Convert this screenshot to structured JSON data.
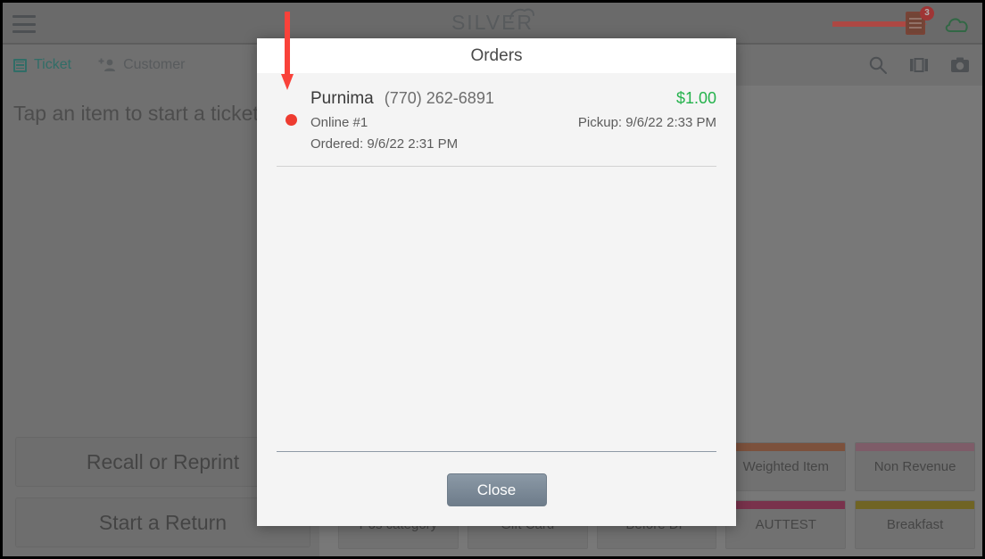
{
  "topbar": {
    "menu_icon": "hamburger-menu-icon",
    "logo_text": "SILVER",
    "orders_icon": "orders-receipt-icon",
    "orders_badge": "3",
    "cloud_icon": "cloud-icon",
    "annotation_arrow": "red-arrow-pointing-right"
  },
  "subbar": {
    "tabs": [
      {
        "label": "Ticket",
        "icon": "ticket-icon",
        "active": true
      },
      {
        "label": "Customer",
        "icon": "add-person-icon",
        "active": false
      }
    ],
    "icons": [
      {
        "name": "search-icon"
      },
      {
        "name": "columns-layout-icon"
      },
      {
        "name": "camera-icon"
      }
    ]
  },
  "ticket_pane": {
    "hint": "Tap an item to start a ticket",
    "actions": [
      {
        "label": "Recall or Reprint"
      },
      {
        "label": "Start a Return"
      }
    ]
  },
  "grid_pane": {
    "rows": [
      [
        {
          "label": "",
          "color": "#8d8d8d",
          "blank": true
        },
        {
          "label": "",
          "color": "#8d8d8d",
          "blank": true
        },
        {
          "label": "",
          "color": "#8d8d8d",
          "blank": true
        },
        {
          "label": "Weighted Item",
          "color": "#a0522d"
        },
        {
          "label": "Non Revenue",
          "color": "#a5677c"
        }
      ],
      [
        {
          "label": "Pos category",
          "color": "#8d8d8d",
          "blank": true
        },
        {
          "label": "Gift Card",
          "color": "#8d8d8d",
          "blank": true
        },
        {
          "label": "Before DP",
          "color": "#8d8d8d",
          "blank": true
        },
        {
          "label": "AUTTEST",
          "color": "#9b1b4a"
        },
        {
          "label": "Breakfast",
          "color": "#8b7500"
        }
      ]
    ]
  },
  "dialog": {
    "title": "Orders",
    "annotation_arrow": "red-arrow-pointing-down",
    "orders": [
      {
        "status_color": "#ee3b30",
        "customer_name": "Purnima",
        "customer_phone": "(770) 262-6891",
        "total": "$1.00",
        "channel": "Online #1",
        "pickup": "Pickup: 9/6/22 2:33 PM",
        "ordered": "Ordered: 9/6/22 2:31 PM"
      }
    ],
    "close_label": "Close"
  },
  "colors": {
    "accent_teal": "#18857a",
    "money_green": "#24b24c",
    "alert_red": "#ee3b30",
    "annotation_red": "#f9423a"
  }
}
